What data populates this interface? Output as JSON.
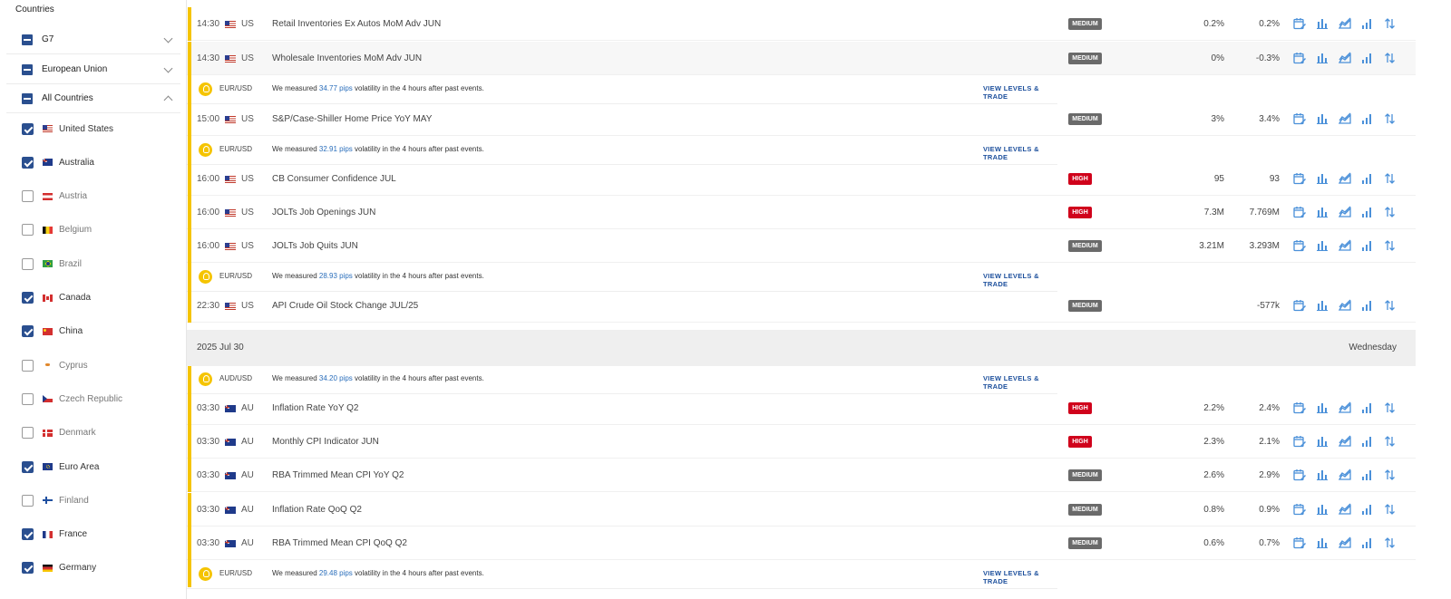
{
  "sidebar": {
    "title": "Countries",
    "groups": [
      {
        "label": "G7",
        "expanded": false
      },
      {
        "label": "European Union",
        "expanded": false
      },
      {
        "label": "All Countries",
        "expanded": true
      }
    ],
    "countries": [
      {
        "name": "United States",
        "checked": true,
        "flag": "us"
      },
      {
        "name": "Australia",
        "checked": true,
        "flag": "au"
      },
      {
        "name": "Austria",
        "checked": false,
        "flag": "at"
      },
      {
        "name": "Belgium",
        "checked": false,
        "flag": "be"
      },
      {
        "name": "Brazil",
        "checked": false,
        "flag": "br"
      },
      {
        "name": "Canada",
        "checked": true,
        "flag": "ca"
      },
      {
        "name": "China",
        "checked": true,
        "flag": "cn"
      },
      {
        "name": "Cyprus",
        "checked": false,
        "flag": "cy"
      },
      {
        "name": "Czech Republic",
        "checked": false,
        "flag": "cz"
      },
      {
        "name": "Denmark",
        "checked": false,
        "flag": "dk"
      },
      {
        "name": "Euro Area",
        "checked": true,
        "flag": "eu"
      },
      {
        "name": "Finland",
        "checked": false,
        "flag": "fi"
      },
      {
        "name": "France",
        "checked": true,
        "flag": "fr"
      },
      {
        "name": "Germany",
        "checked": true,
        "flag": "de"
      }
    ]
  },
  "colors": {
    "accent": "#2a4f8f",
    "highlight": "#f5c400",
    "high": "#d0021b",
    "medium": "#6a6a6a",
    "link": "#1c4f9c",
    "pips": "#2a6ebb",
    "icon": "#4a90d9"
  },
  "calendar": {
    "day_header": {
      "date": "2025 Jul 30",
      "weekday": "Wednesday"
    },
    "view_link_label": "VIEW LEVELS & TRADE",
    "volatility_prefix": "We measured",
    "volatility_suffix": "volatility in the 4 hours after past events.",
    "rows": [
      {
        "kind": "event",
        "time": "14:30",
        "flag": "us",
        "country": "US",
        "name": "Retail Inventories Ex Autos MoM Adv JUN",
        "impact": "MEDIUM",
        "actual": "0.2%",
        "previous": "0.2%"
      },
      {
        "kind": "event",
        "time": "14:30",
        "flag": "us",
        "country": "US",
        "name": "Wholesale Inventories MoM Adv JUN",
        "impact": "MEDIUM",
        "actual": "0%",
        "previous": "-0.3%"
      },
      {
        "kind": "vol",
        "pair": "EUR/USD",
        "pips": "34.77 pips"
      },
      {
        "kind": "event",
        "time": "15:00",
        "flag": "us",
        "country": "US",
        "name": "S&P/Case-Shiller Home Price YoY MAY",
        "impact": "MEDIUM",
        "actual": "3%",
        "previous": "3.4%"
      },
      {
        "kind": "vol",
        "pair": "EUR/USD",
        "pips": "32.91 pips"
      },
      {
        "kind": "event",
        "time": "16:00",
        "flag": "us",
        "country": "US",
        "name": "CB Consumer Confidence JUL",
        "impact": "HIGH",
        "actual": "95",
        "previous": "93"
      },
      {
        "kind": "event",
        "time": "16:00",
        "flag": "us",
        "country": "US",
        "name": "JOLTs Job Openings JUN",
        "impact": "HIGH",
        "actual": "7.3M",
        "previous": "7.769M"
      },
      {
        "kind": "event",
        "time": "16:00",
        "flag": "us",
        "country": "US",
        "name": "JOLTs Job Quits JUN",
        "impact": "MEDIUM",
        "actual": "3.21M",
        "previous": "3.293M"
      },
      {
        "kind": "vol",
        "pair": "EUR/USD",
        "pips": "28.93 pips"
      },
      {
        "kind": "event",
        "time": "22:30",
        "flag": "us",
        "country": "US",
        "name": "API Crude Oil Stock Change JUL/25",
        "impact": "MEDIUM",
        "actual": "",
        "previous": "-577k"
      },
      {
        "kind": "vol",
        "pair": "AUD/USD",
        "pips": "34.20 pips"
      },
      {
        "kind": "event",
        "time": "03:30",
        "flag": "au",
        "country": "AU",
        "name": "Inflation Rate YoY Q2",
        "impact": "HIGH",
        "actual": "2.2%",
        "previous": "2.4%"
      },
      {
        "kind": "event",
        "time": "03:30",
        "flag": "au",
        "country": "AU",
        "name": "Monthly CPI Indicator JUN",
        "impact": "HIGH",
        "actual": "2.3%",
        "previous": "2.1%"
      },
      {
        "kind": "event",
        "time": "03:30",
        "flag": "au",
        "country": "AU",
        "name": "RBA Trimmed Mean CPI YoY Q2",
        "impact": "MEDIUM",
        "actual": "2.6%",
        "previous": "2.9%"
      },
      {
        "kind": "event",
        "time": "03:30",
        "flag": "au",
        "country": "AU",
        "name": "Inflation Rate QoQ Q2",
        "impact": "MEDIUM",
        "actual": "0.8%",
        "previous": "0.9%"
      },
      {
        "kind": "event",
        "time": "03:30",
        "flag": "au",
        "country": "AU",
        "name": "RBA Trimmed Mean CPI QoQ Q2",
        "impact": "MEDIUM",
        "actual": "0.6%",
        "previous": "0.7%"
      },
      {
        "kind": "vol",
        "pair": "EUR/USD",
        "pips": "29.48 pips"
      }
    ],
    "row_icons": [
      "calendar-edit-icon",
      "bar-chart-icon",
      "area-chart-icon",
      "signal-bars-icon",
      "sort-arrows-icon"
    ]
  }
}
